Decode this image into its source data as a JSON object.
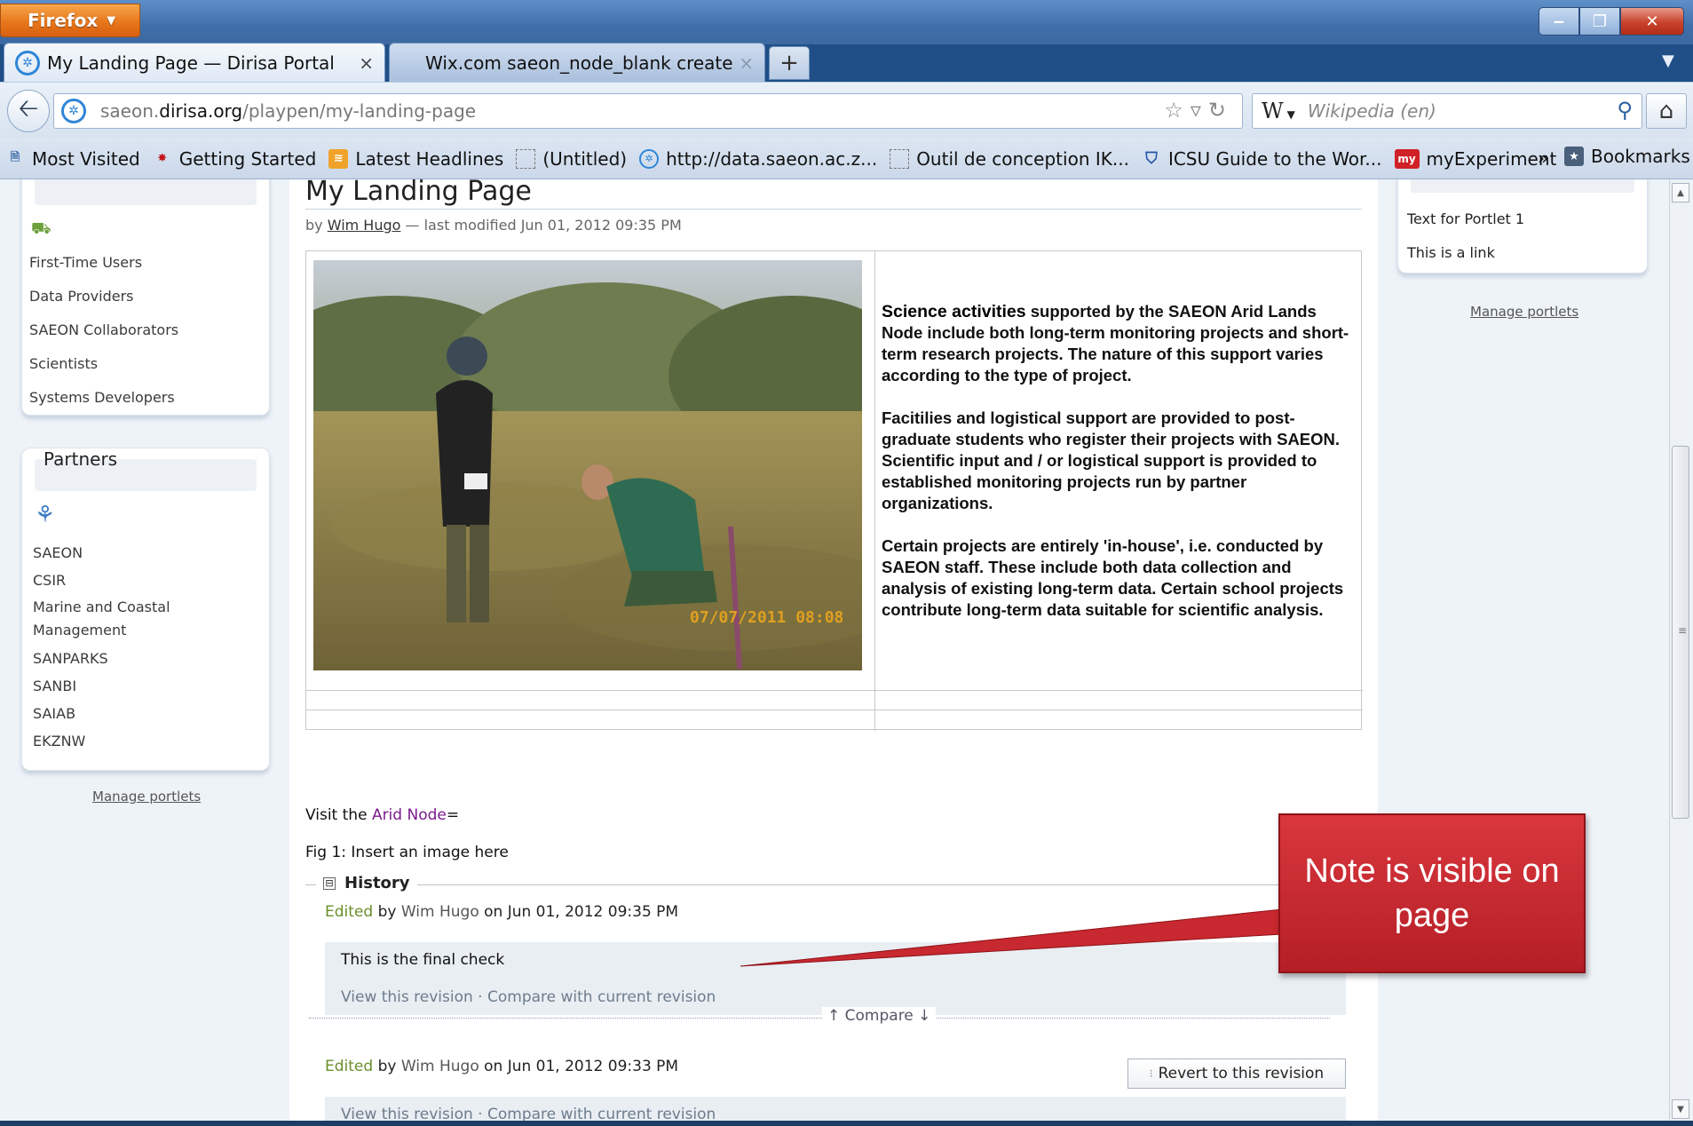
{
  "window": {
    "firefox_button": "Firefox",
    "min": "‒",
    "max": "❐",
    "close": "✕"
  },
  "tabs": [
    {
      "label": "My Landing Page — Dirisa Portal",
      "close": "×",
      "active": true
    },
    {
      "label": "Wix.com saeon_node_blank created b...",
      "close": "×",
      "active": false
    }
  ],
  "new_tab": "+",
  "nav": {
    "url_domain_prefix": "saeon.",
    "url_domain": "dirisa.org",
    "url_path": "/playpen/my-landing-page",
    "search_engine": "W",
    "search_placeholder": "Wikipedia (en)"
  },
  "bookmarks": [
    {
      "label": "Most Visited",
      "icon": "page-icon"
    },
    {
      "label": "Getting Started",
      "icon": "firefox-icon"
    },
    {
      "label": "Latest Headlines",
      "icon": "rss-icon"
    },
    {
      "label": "(Untitled)",
      "icon": "blank-page-icon"
    },
    {
      "label": "http://data.saeon.ac.z...",
      "icon": "globe-icon"
    },
    {
      "label": "Outil de conception IK...",
      "icon": "blank-page-icon"
    },
    {
      "label": "ICSU Guide to the Wor...",
      "icon": "shield-icon"
    },
    {
      "label": "myExperiment",
      "icon": "my-badge-icon",
      "badge": "my"
    }
  ],
  "bookmarks_overflow": "»",
  "bookmarks_menu": "Bookmarks",
  "left_portlets": {
    "users_links": [
      "First-Time Users",
      "Data Providers",
      "SAEON Collaborators",
      "Scientists",
      "Systems Developers"
    ],
    "partners_title": "Partners",
    "partners_links": [
      "SAEON",
      "CSIR",
      "Marine and Coastal Management",
      "SANPARKS",
      "SANBI",
      "SAIAB",
      "EKZNW"
    ],
    "manage": "Manage portlets"
  },
  "right_portlet": {
    "items": [
      "Text for Portlet 1",
      "This is a link"
    ],
    "manage": "Manage portlets"
  },
  "page": {
    "title": "My Landing Page",
    "byline_prefix": "by",
    "author": "Wim Hugo",
    "byline_suffix": "— last modified Jun 01, 2012 09:35 PM",
    "photo_stamp": "07/07/2011  08:08",
    "article": {
      "p1_bold": "Science activities",
      "p1_rest": " supported by the SAEON Arid Lands Node include both long-term monitoring projects and short-term research projects. The nature of this support varies according to the type of project.",
      "p2": "Facitilies and logistical support are provided to post-graduate students who register their projects with SAEON. Scientific input and / or logistical support is provided to established monitoring projects run by partner organizations.",
      "p3": "Certain projects are entirely 'in-house', i.e. conducted by SAEON staff. These include both data collection and analysis of existing long-term data. Certain school projects contribute long-term data suitable for scientific analysis."
    },
    "visit_prefix": "Visit the ",
    "visit_link": "Arid Node",
    "visit_suffix": "=",
    "fig_caption": "Fig 1: Insert an image here"
  },
  "history": {
    "legend_toggle": "⊟",
    "title": "History",
    "entries": [
      {
        "action": "Edited",
        "by": "by",
        "author": "Wim Hugo",
        "when": "on Jun 01, 2012 09:35 PM",
        "note": "This is the final check",
        "links": "View this revision · Compare with current revision"
      },
      {
        "action": "Edited",
        "by": "by",
        "author": "Wim Hugo",
        "when": "on Jun 01, 2012 09:33 PM",
        "note": "",
        "links": "View this revision · Compare with current revision"
      }
    ],
    "compare": "↑ Compare ↓",
    "revert": "Revert to this revision"
  },
  "callout": {
    "text": "Note is visible on page",
    "color": "#c8282f"
  }
}
